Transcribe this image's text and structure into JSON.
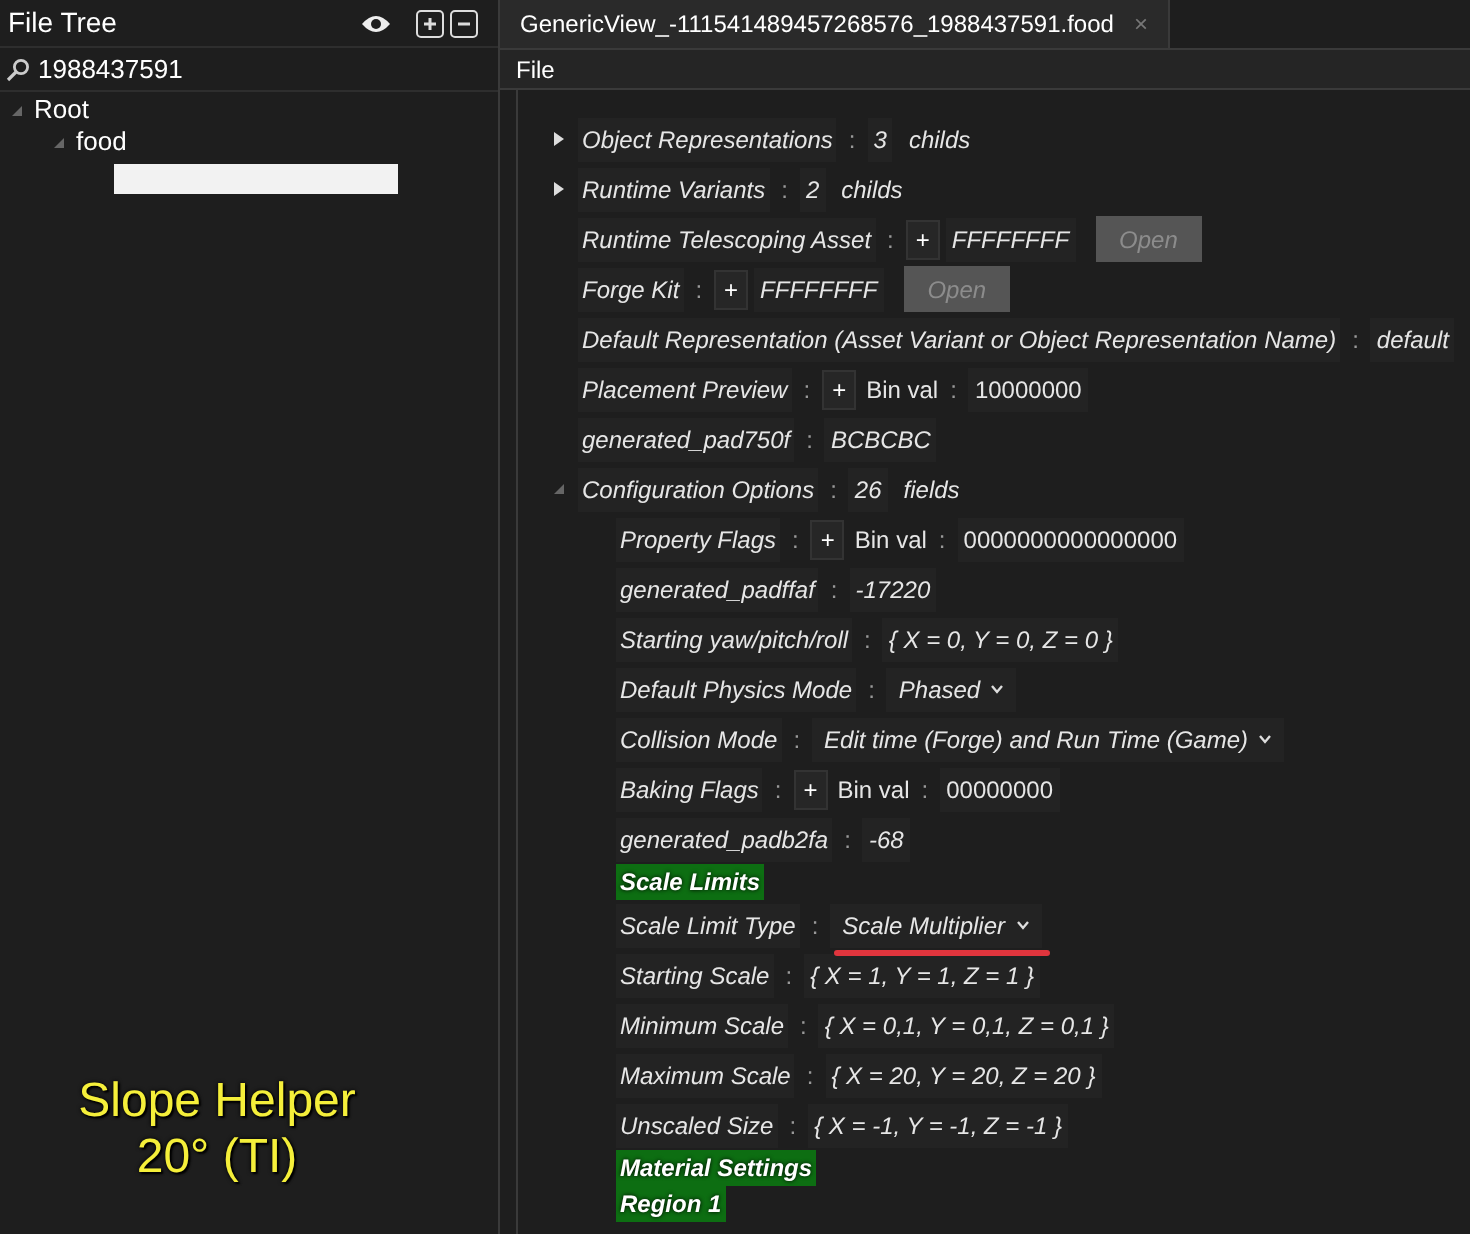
{
  "file_tree": {
    "title": "File Tree",
    "search": {
      "value": "1988437591"
    },
    "nodes": [
      {
        "label": "Root",
        "expanded": true,
        "children": [
          {
            "label": "food",
            "expanded": true
          }
        ]
      }
    ]
  },
  "caption": {
    "lines": [
      "Slope Helper",
      "20° (TI)"
    ]
  },
  "tabs": [
    {
      "label": "GenericView_-111541489457268576_1988437591.food",
      "close": "×",
      "selected": true
    }
  ],
  "menu": [
    "File"
  ],
  "rows": [
    {
      "kind": "expander",
      "label": "Object Representations",
      "colon": ":",
      "count": "3",
      "unit": "childs",
      "expanded": false
    },
    {
      "kind": "expander",
      "label": "Runtime Variants",
      "colon": ":",
      "count": "2",
      "unit": "childs",
      "expanded": false
    },
    {
      "kind": "asset",
      "label": "Runtime Telescoping Asset",
      "colon": ":",
      "plus": "+",
      "value": "FFFFFFFF",
      "button": "Open",
      "disabled": true
    },
    {
      "kind": "asset",
      "label": "Forge Kit",
      "colon": ":",
      "plus": "+",
      "value": "FFFFFFFF",
      "button": "Open",
      "disabled": true
    },
    {
      "kind": "text",
      "label": "Default Representation (Asset Variant or Object Representation Name)",
      "colon": ":",
      "value": "default"
    },
    {
      "kind": "flags",
      "label": "Placement Preview",
      "colon": ":",
      "plus": "+",
      "bin_label": "Bin val",
      "bin_colon": ":",
      "value": "10000000"
    },
    {
      "kind": "text",
      "label": "generated_pad750f",
      "colon": ":",
      "value": "BCBCBC"
    },
    {
      "kind": "expander",
      "label": "Configuration Options",
      "colon": ":",
      "count": "26",
      "unit": "fields",
      "expanded": true,
      "children": [
        {
          "kind": "flags",
          "label": "Property Flags",
          "colon": ":",
          "plus": "+",
          "bin_label": "Bin val",
          "bin_colon": ":",
          "value": "0000000000000000"
        },
        {
          "kind": "text",
          "label": "generated_padffaf",
          "colon": ":",
          "value": "-17220"
        },
        {
          "kind": "text",
          "label": "Starting yaw/pitch/roll",
          "colon": ":",
          "value": "{ X = 0, Y = 0, Z = 0 }"
        },
        {
          "kind": "dropdown",
          "label": "Default Physics Mode",
          "colon": ":",
          "value": "Phased",
          "underlined": false
        },
        {
          "kind": "dropdown",
          "label": "Collision Mode",
          "colon": ":",
          "value": "Edit time (Forge) and Run Time (Game)",
          "underlined": false
        },
        {
          "kind": "flags",
          "label": "Baking Flags",
          "colon": ":",
          "plus": "+",
          "bin_label": "Bin val",
          "bin_colon": ":",
          "value": "00000000"
        },
        {
          "kind": "text",
          "label": "generated_padb2fa",
          "colon": ":",
          "value": "-68"
        },
        {
          "kind": "header",
          "label": "Scale Limits"
        },
        {
          "kind": "dropdown",
          "label": "Scale Limit Type",
          "colon": ":",
          "value": "Scale Multiplier",
          "underlined": true
        },
        {
          "kind": "text",
          "label": "Starting Scale",
          "colon": ":",
          "value": "{ X = 1, Y = 1, Z = 1 }"
        },
        {
          "kind": "text",
          "label": "Minimum Scale",
          "colon": ":",
          "value": "{ X = 0,1, Y = 0,1, Z = 0,1 }"
        },
        {
          "kind": "text",
          "label": "Maximum Scale",
          "colon": ":",
          "value": "{ X = 20, Y = 20, Z = 20 }"
        },
        {
          "kind": "text",
          "label": "Unscaled Size",
          "colon": ":",
          "value": "{ X = -1, Y = -1, Z = -1 }"
        },
        {
          "kind": "header",
          "label": "Material Settings"
        },
        {
          "kind": "header",
          "label": "Region 1"
        }
      ]
    }
  ]
}
